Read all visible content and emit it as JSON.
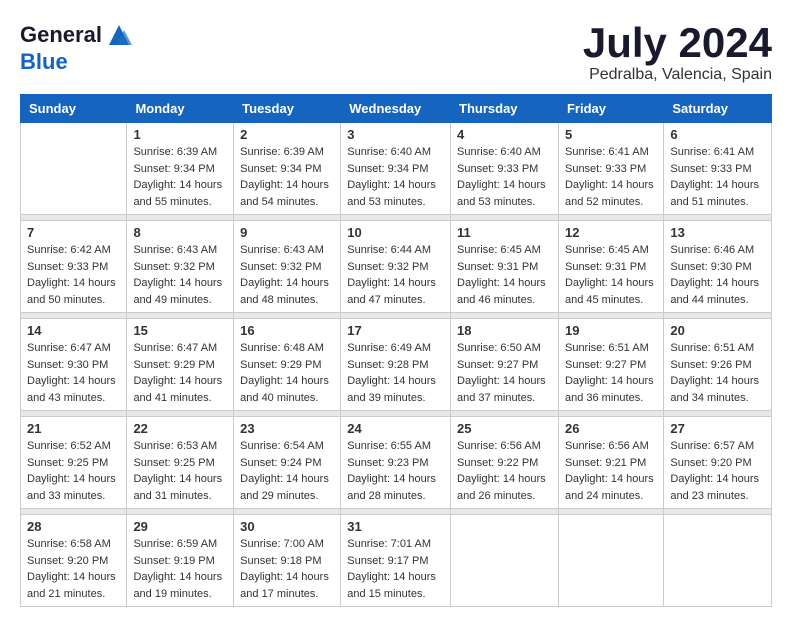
{
  "header": {
    "logo": {
      "general": "General",
      "blue": "Blue"
    },
    "title": "July 2024",
    "location": "Pedralba, Valencia, Spain"
  },
  "calendar": {
    "days_of_week": [
      "Sunday",
      "Monday",
      "Tuesday",
      "Wednesday",
      "Thursday",
      "Friday",
      "Saturday"
    ],
    "weeks": [
      [
        {
          "day": "",
          "info": ""
        },
        {
          "day": "1",
          "info": "Sunrise: 6:39 AM\nSunset: 9:34 PM\nDaylight: 14 hours\nand 55 minutes."
        },
        {
          "day": "2",
          "info": "Sunrise: 6:39 AM\nSunset: 9:34 PM\nDaylight: 14 hours\nand 54 minutes."
        },
        {
          "day": "3",
          "info": "Sunrise: 6:40 AM\nSunset: 9:34 PM\nDaylight: 14 hours\nand 53 minutes."
        },
        {
          "day": "4",
          "info": "Sunrise: 6:40 AM\nSunset: 9:33 PM\nDaylight: 14 hours\nand 53 minutes."
        },
        {
          "day": "5",
          "info": "Sunrise: 6:41 AM\nSunset: 9:33 PM\nDaylight: 14 hours\nand 52 minutes."
        },
        {
          "day": "6",
          "info": "Sunrise: 6:41 AM\nSunset: 9:33 PM\nDaylight: 14 hours\nand 51 minutes."
        }
      ],
      [
        {
          "day": "7",
          "info": "Sunrise: 6:42 AM\nSunset: 9:33 PM\nDaylight: 14 hours\nand 50 minutes."
        },
        {
          "day": "8",
          "info": "Sunrise: 6:43 AM\nSunset: 9:32 PM\nDaylight: 14 hours\nand 49 minutes."
        },
        {
          "day": "9",
          "info": "Sunrise: 6:43 AM\nSunset: 9:32 PM\nDaylight: 14 hours\nand 48 minutes."
        },
        {
          "day": "10",
          "info": "Sunrise: 6:44 AM\nSunset: 9:32 PM\nDaylight: 14 hours\nand 47 minutes."
        },
        {
          "day": "11",
          "info": "Sunrise: 6:45 AM\nSunset: 9:31 PM\nDaylight: 14 hours\nand 46 minutes."
        },
        {
          "day": "12",
          "info": "Sunrise: 6:45 AM\nSunset: 9:31 PM\nDaylight: 14 hours\nand 45 minutes."
        },
        {
          "day": "13",
          "info": "Sunrise: 6:46 AM\nSunset: 9:30 PM\nDaylight: 14 hours\nand 44 minutes."
        }
      ],
      [
        {
          "day": "14",
          "info": "Sunrise: 6:47 AM\nSunset: 9:30 PM\nDaylight: 14 hours\nand 43 minutes."
        },
        {
          "day": "15",
          "info": "Sunrise: 6:47 AM\nSunset: 9:29 PM\nDaylight: 14 hours\nand 41 minutes."
        },
        {
          "day": "16",
          "info": "Sunrise: 6:48 AM\nSunset: 9:29 PM\nDaylight: 14 hours\nand 40 minutes."
        },
        {
          "day": "17",
          "info": "Sunrise: 6:49 AM\nSunset: 9:28 PM\nDaylight: 14 hours\nand 39 minutes."
        },
        {
          "day": "18",
          "info": "Sunrise: 6:50 AM\nSunset: 9:27 PM\nDaylight: 14 hours\nand 37 minutes."
        },
        {
          "day": "19",
          "info": "Sunrise: 6:51 AM\nSunset: 9:27 PM\nDaylight: 14 hours\nand 36 minutes."
        },
        {
          "day": "20",
          "info": "Sunrise: 6:51 AM\nSunset: 9:26 PM\nDaylight: 14 hours\nand 34 minutes."
        }
      ],
      [
        {
          "day": "21",
          "info": "Sunrise: 6:52 AM\nSunset: 9:25 PM\nDaylight: 14 hours\nand 33 minutes."
        },
        {
          "day": "22",
          "info": "Sunrise: 6:53 AM\nSunset: 9:25 PM\nDaylight: 14 hours\nand 31 minutes."
        },
        {
          "day": "23",
          "info": "Sunrise: 6:54 AM\nSunset: 9:24 PM\nDaylight: 14 hours\nand 29 minutes."
        },
        {
          "day": "24",
          "info": "Sunrise: 6:55 AM\nSunset: 9:23 PM\nDaylight: 14 hours\nand 28 minutes."
        },
        {
          "day": "25",
          "info": "Sunrise: 6:56 AM\nSunset: 9:22 PM\nDaylight: 14 hours\nand 26 minutes."
        },
        {
          "day": "26",
          "info": "Sunrise: 6:56 AM\nSunset: 9:21 PM\nDaylight: 14 hours\nand 24 minutes."
        },
        {
          "day": "27",
          "info": "Sunrise: 6:57 AM\nSunset: 9:20 PM\nDaylight: 14 hours\nand 23 minutes."
        }
      ],
      [
        {
          "day": "28",
          "info": "Sunrise: 6:58 AM\nSunset: 9:20 PM\nDaylight: 14 hours\nand 21 minutes."
        },
        {
          "day": "29",
          "info": "Sunrise: 6:59 AM\nSunset: 9:19 PM\nDaylight: 14 hours\nand 19 minutes."
        },
        {
          "day": "30",
          "info": "Sunrise: 7:00 AM\nSunset: 9:18 PM\nDaylight: 14 hours\nand 17 minutes."
        },
        {
          "day": "31",
          "info": "Sunrise: 7:01 AM\nSunset: 9:17 PM\nDaylight: 14 hours\nand 15 minutes."
        },
        {
          "day": "",
          "info": ""
        },
        {
          "day": "",
          "info": ""
        },
        {
          "day": "",
          "info": ""
        }
      ]
    ]
  }
}
